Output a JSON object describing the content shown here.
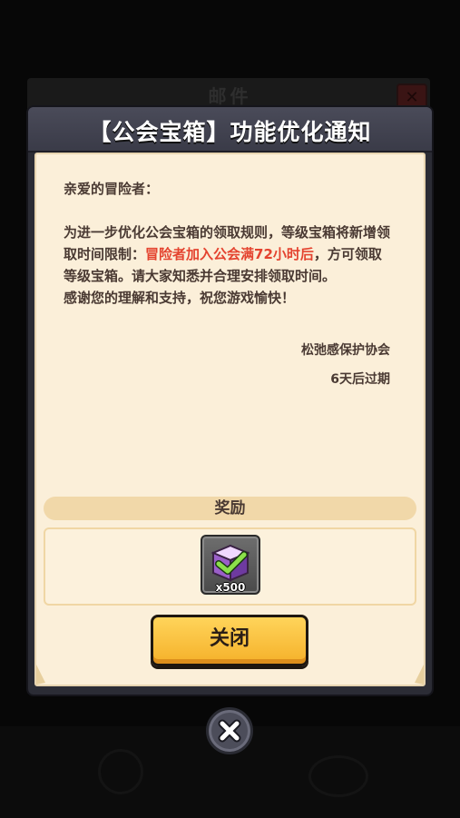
{
  "background": {
    "panel_title": "邮件"
  },
  "dialog": {
    "title": "【公会宝箱】功能优化通知",
    "greeting": "亲爱的冒险者：",
    "body_part1": "为进一步优化公会宝箱的领取规则，等级宝箱将新增领取时间限制：",
    "body_highlight": "冒险者加入公会满72小时后",
    "body_part2": "，方可领取等级宝箱。请大家知悉并合理安排领取时间。",
    "body_thanks": "感谢您的理解和支持，祝您游戏愉快！",
    "signature": "松弛感保护协会",
    "expiry": "6天后过期",
    "reward_header": "奖励",
    "reward_item": {
      "icon": "gem-chest-icon",
      "quantity": "x500"
    },
    "close_button_label": "关闭"
  },
  "colors": {
    "highlight_red": "#e4432f",
    "paper": "#fbefd9",
    "button_yellow": "#ffd45a",
    "header_dark": "#3a3b48"
  }
}
